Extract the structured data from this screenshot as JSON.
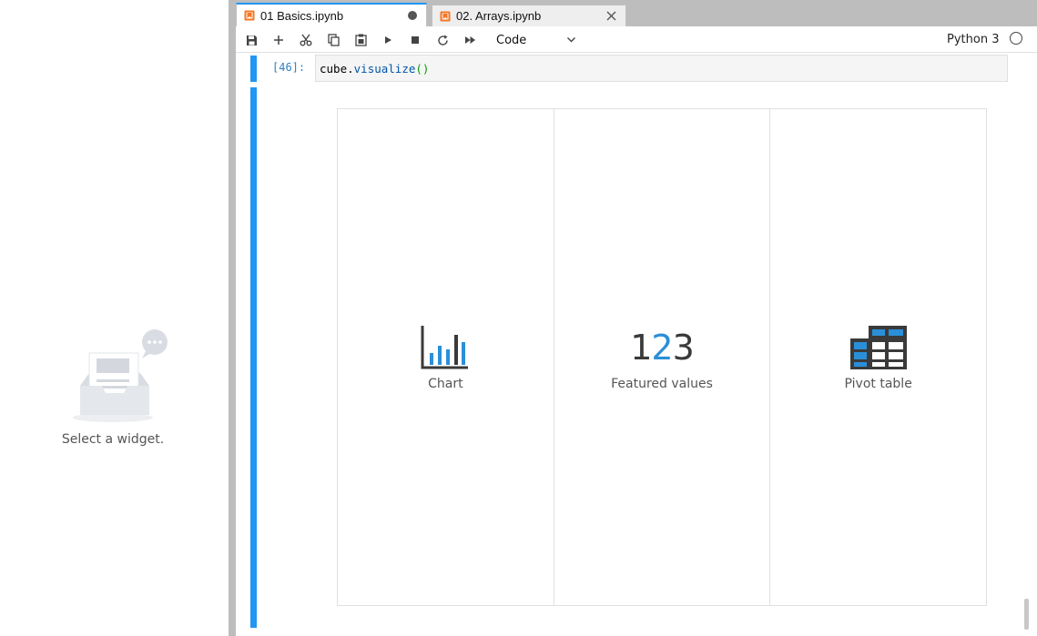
{
  "sidebar": {
    "empty_message": "Select a widget."
  },
  "tabs": [
    {
      "label": "01 Basics.ipynb",
      "active": true,
      "dirty": true
    },
    {
      "label": "02. Arrays.ipynb",
      "active": false,
      "dirty": false
    }
  ],
  "toolbar": {
    "buttons": [
      "save-icon",
      "add-icon",
      "cut-icon",
      "copy-icon",
      "paste-icon",
      "run-icon",
      "stop-icon",
      "restart-icon",
      "fast-forward-icon"
    ],
    "cell_type": "Code",
    "kernel_name": "Python 3"
  },
  "cell": {
    "prompt": "[46]:",
    "code_object": "cube",
    "code_dot": ".",
    "code_function": "visualize",
    "code_parens": "()"
  },
  "widget": {
    "options": [
      {
        "label": "Chart",
        "icon": "bar-chart-icon"
      },
      {
        "label": "Featured values",
        "icon": "featured-values-icon",
        "glyph_left": "1",
        "glyph_mid": "2",
        "glyph_right": "3"
      },
      {
        "label": "Pivot table",
        "icon": "pivot-table-icon"
      }
    ]
  },
  "colors": {
    "accent": "#2196f3",
    "icon_blue": "#2a8fd8",
    "icon_dark": "#3a3a3a"
  }
}
